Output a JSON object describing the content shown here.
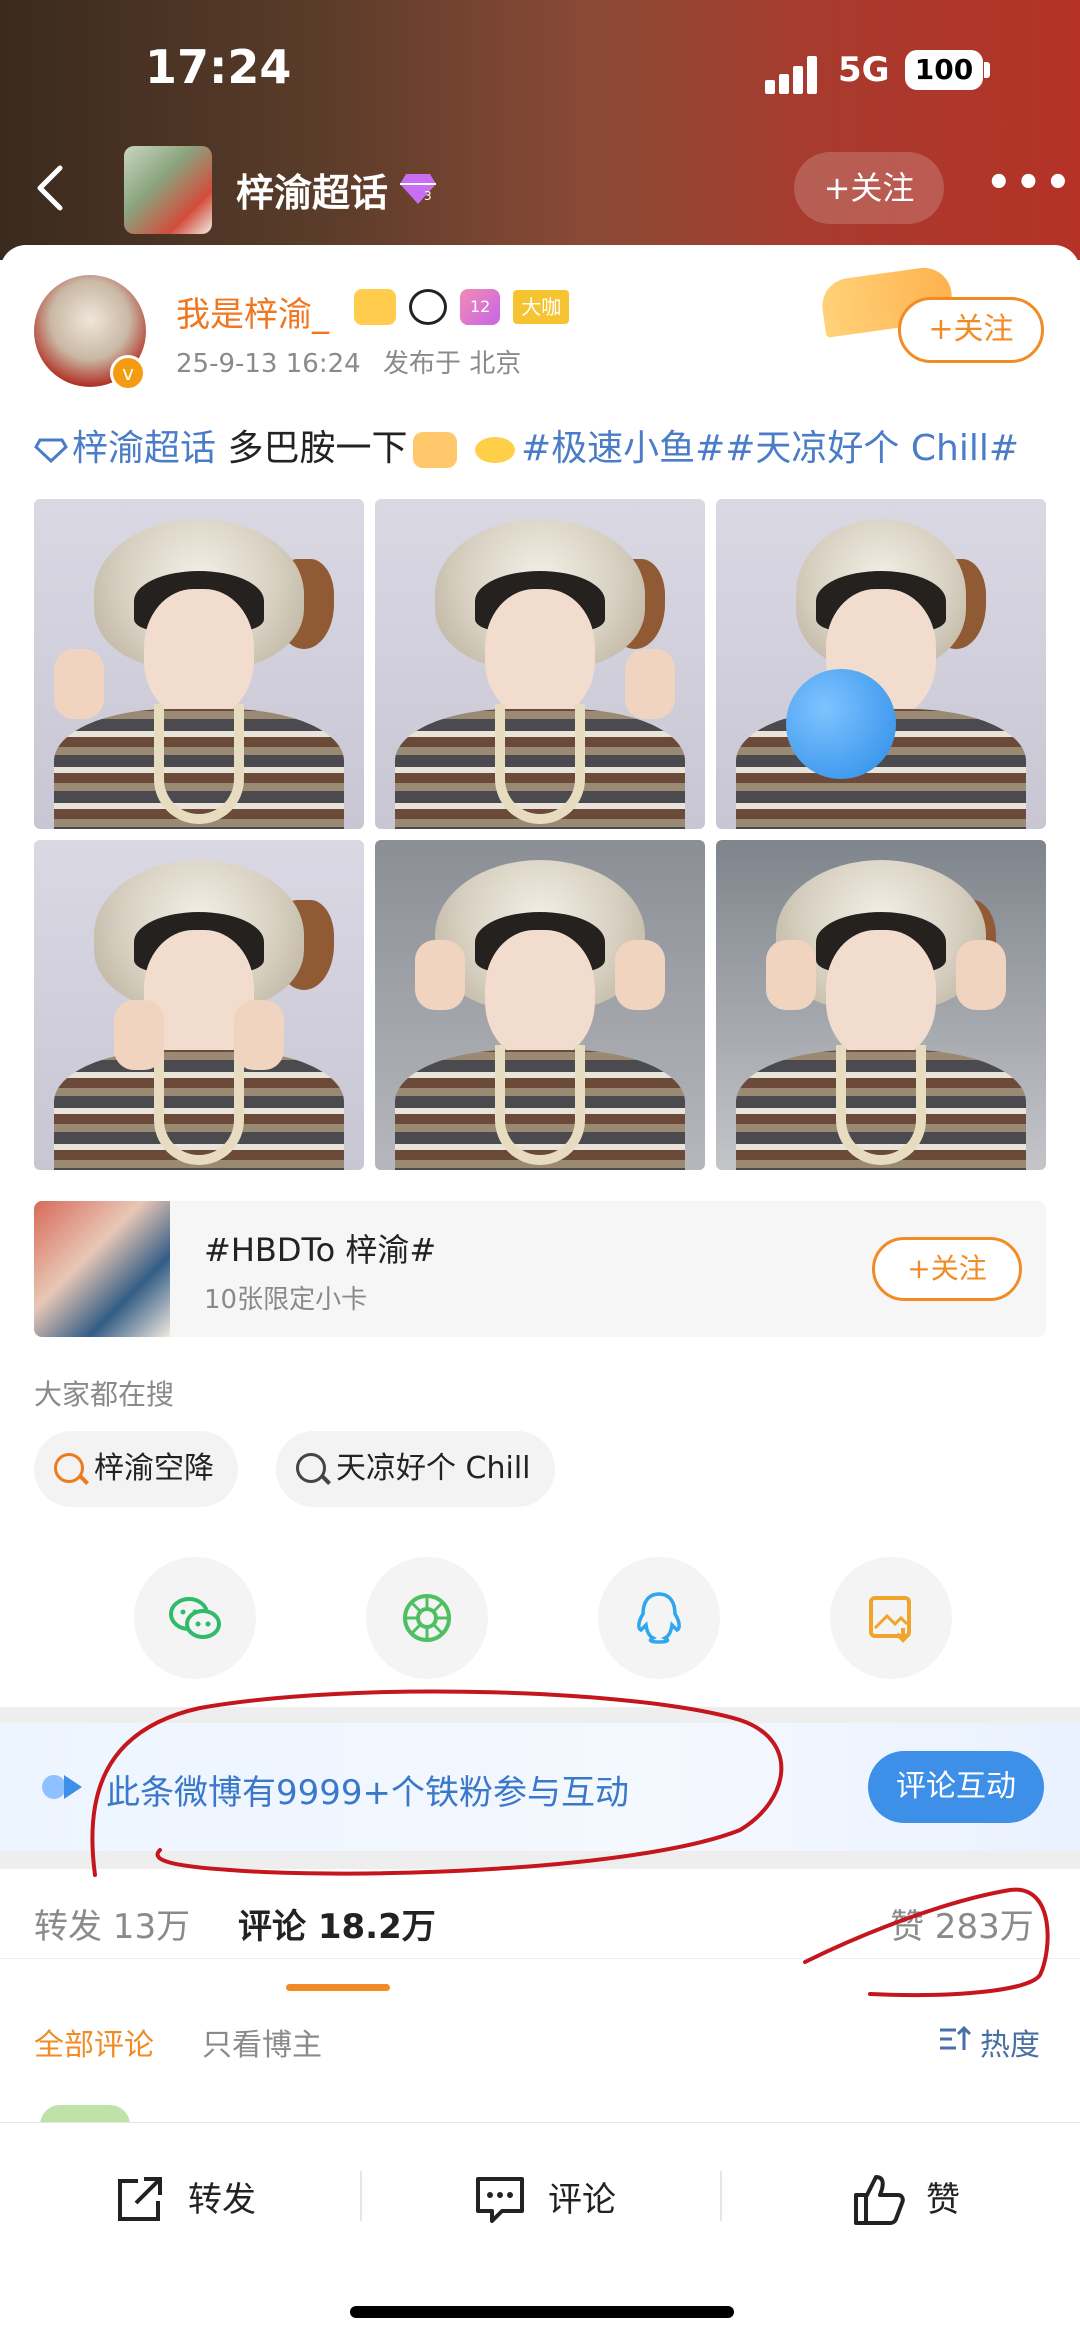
{
  "status_bar": {
    "time": "17:24",
    "network": "5G",
    "battery": "100"
  },
  "nav": {
    "title": "梓渝超话",
    "follow": "+关注",
    "more": "•••"
  },
  "post": {
    "author": "我是梓渝_",
    "badge_label": "大咖",
    "badge_level": "12",
    "date": "25-9-13 16:24",
    "location": "发布于 北京",
    "follow": "+关注",
    "text_tag1": "梓渝超话",
    "text_plain": "多巴胺一下",
    "text_tags": "#极速小鱼##天凉好个 Chill#"
  },
  "topic_card": {
    "title": "#HBDTo 梓渝#",
    "subtitle": "10张限定小卡",
    "follow": "+关注"
  },
  "trending": {
    "title": "大家都在搜",
    "chips": [
      {
        "label": "梓渝空降",
        "icon": "hot-search-icon"
      },
      {
        "label": "天凉好个 Chill",
        "icon": "search-icon"
      }
    ]
  },
  "share": [
    "wechat-icon",
    "moments-icon",
    "qq-icon",
    "save-image-icon"
  ],
  "fans_banner": {
    "text": "此条微博有9999+个铁粉参与互动",
    "button": "评论互动"
  },
  "stats_tabs": {
    "repost": "转发 13万",
    "comment": "评论 18.2万",
    "like": "赞 283万"
  },
  "comment_filter": {
    "all": "全部评论",
    "owner": "只看博主",
    "sort": "热度"
  },
  "bottom_bar": {
    "repost": "转发",
    "comment": "评论",
    "like": "赞"
  },
  "colors": {
    "accent": "#f18b25",
    "link": "#4a7cc7",
    "annotation": "#c4161c"
  }
}
